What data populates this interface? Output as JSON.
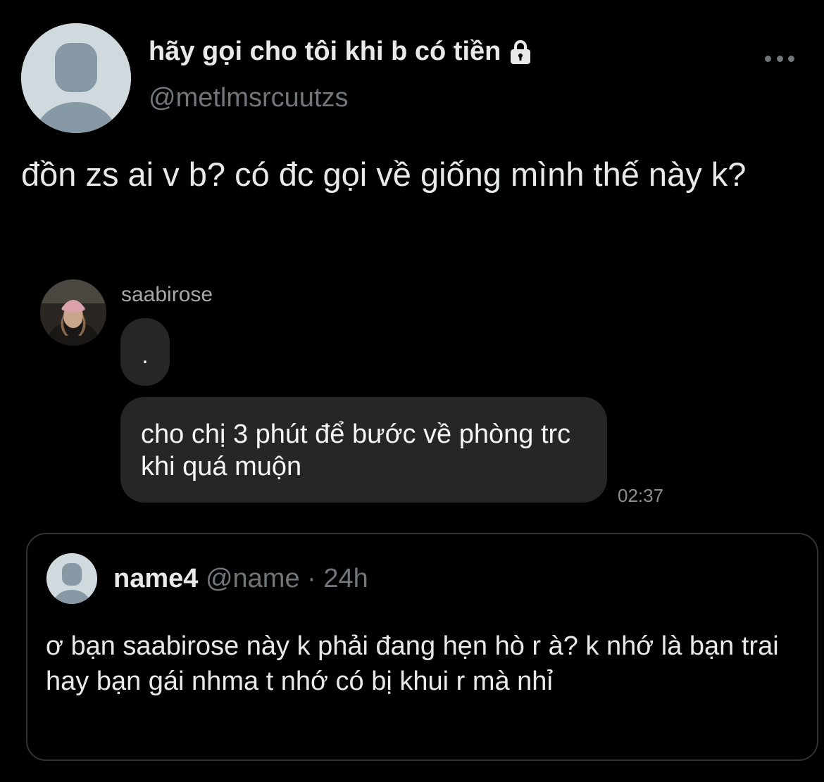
{
  "author": {
    "display_name": "hãy gọi cho tôi khi b có tiền",
    "handle": "@metlmsrcuutzs",
    "protected_icon": "lock-icon",
    "avatar": "default-avatar-placeholder"
  },
  "menu": {
    "icon": "more-horizontal-icon"
  },
  "tweet": {
    "text": "đồn zs ai v b? có đc gọi về giống mình thế này k?"
  },
  "dm_screenshot": {
    "username": "saabirose",
    "messages": [
      {
        "text": "."
      },
      {
        "text": "cho chị 3 phút để bước về phòng trc khi quá muộn"
      }
    ],
    "time": "02:37"
  },
  "quoted_tweet": {
    "name": "name4",
    "handle": "@name",
    "separator": "·",
    "age": "24h",
    "text": "ơ bạn saabirose này k phải đang hẹn hò r à? k nhớ là bạn trai hay bạn gái nhma t nhớ có bị khui r mà nhỉ"
  },
  "colors": {
    "background": "#000000",
    "primary_text": "#e7e9ea",
    "secondary_text": "#71767b",
    "bubble": "#262626",
    "border": "#2f3336"
  }
}
